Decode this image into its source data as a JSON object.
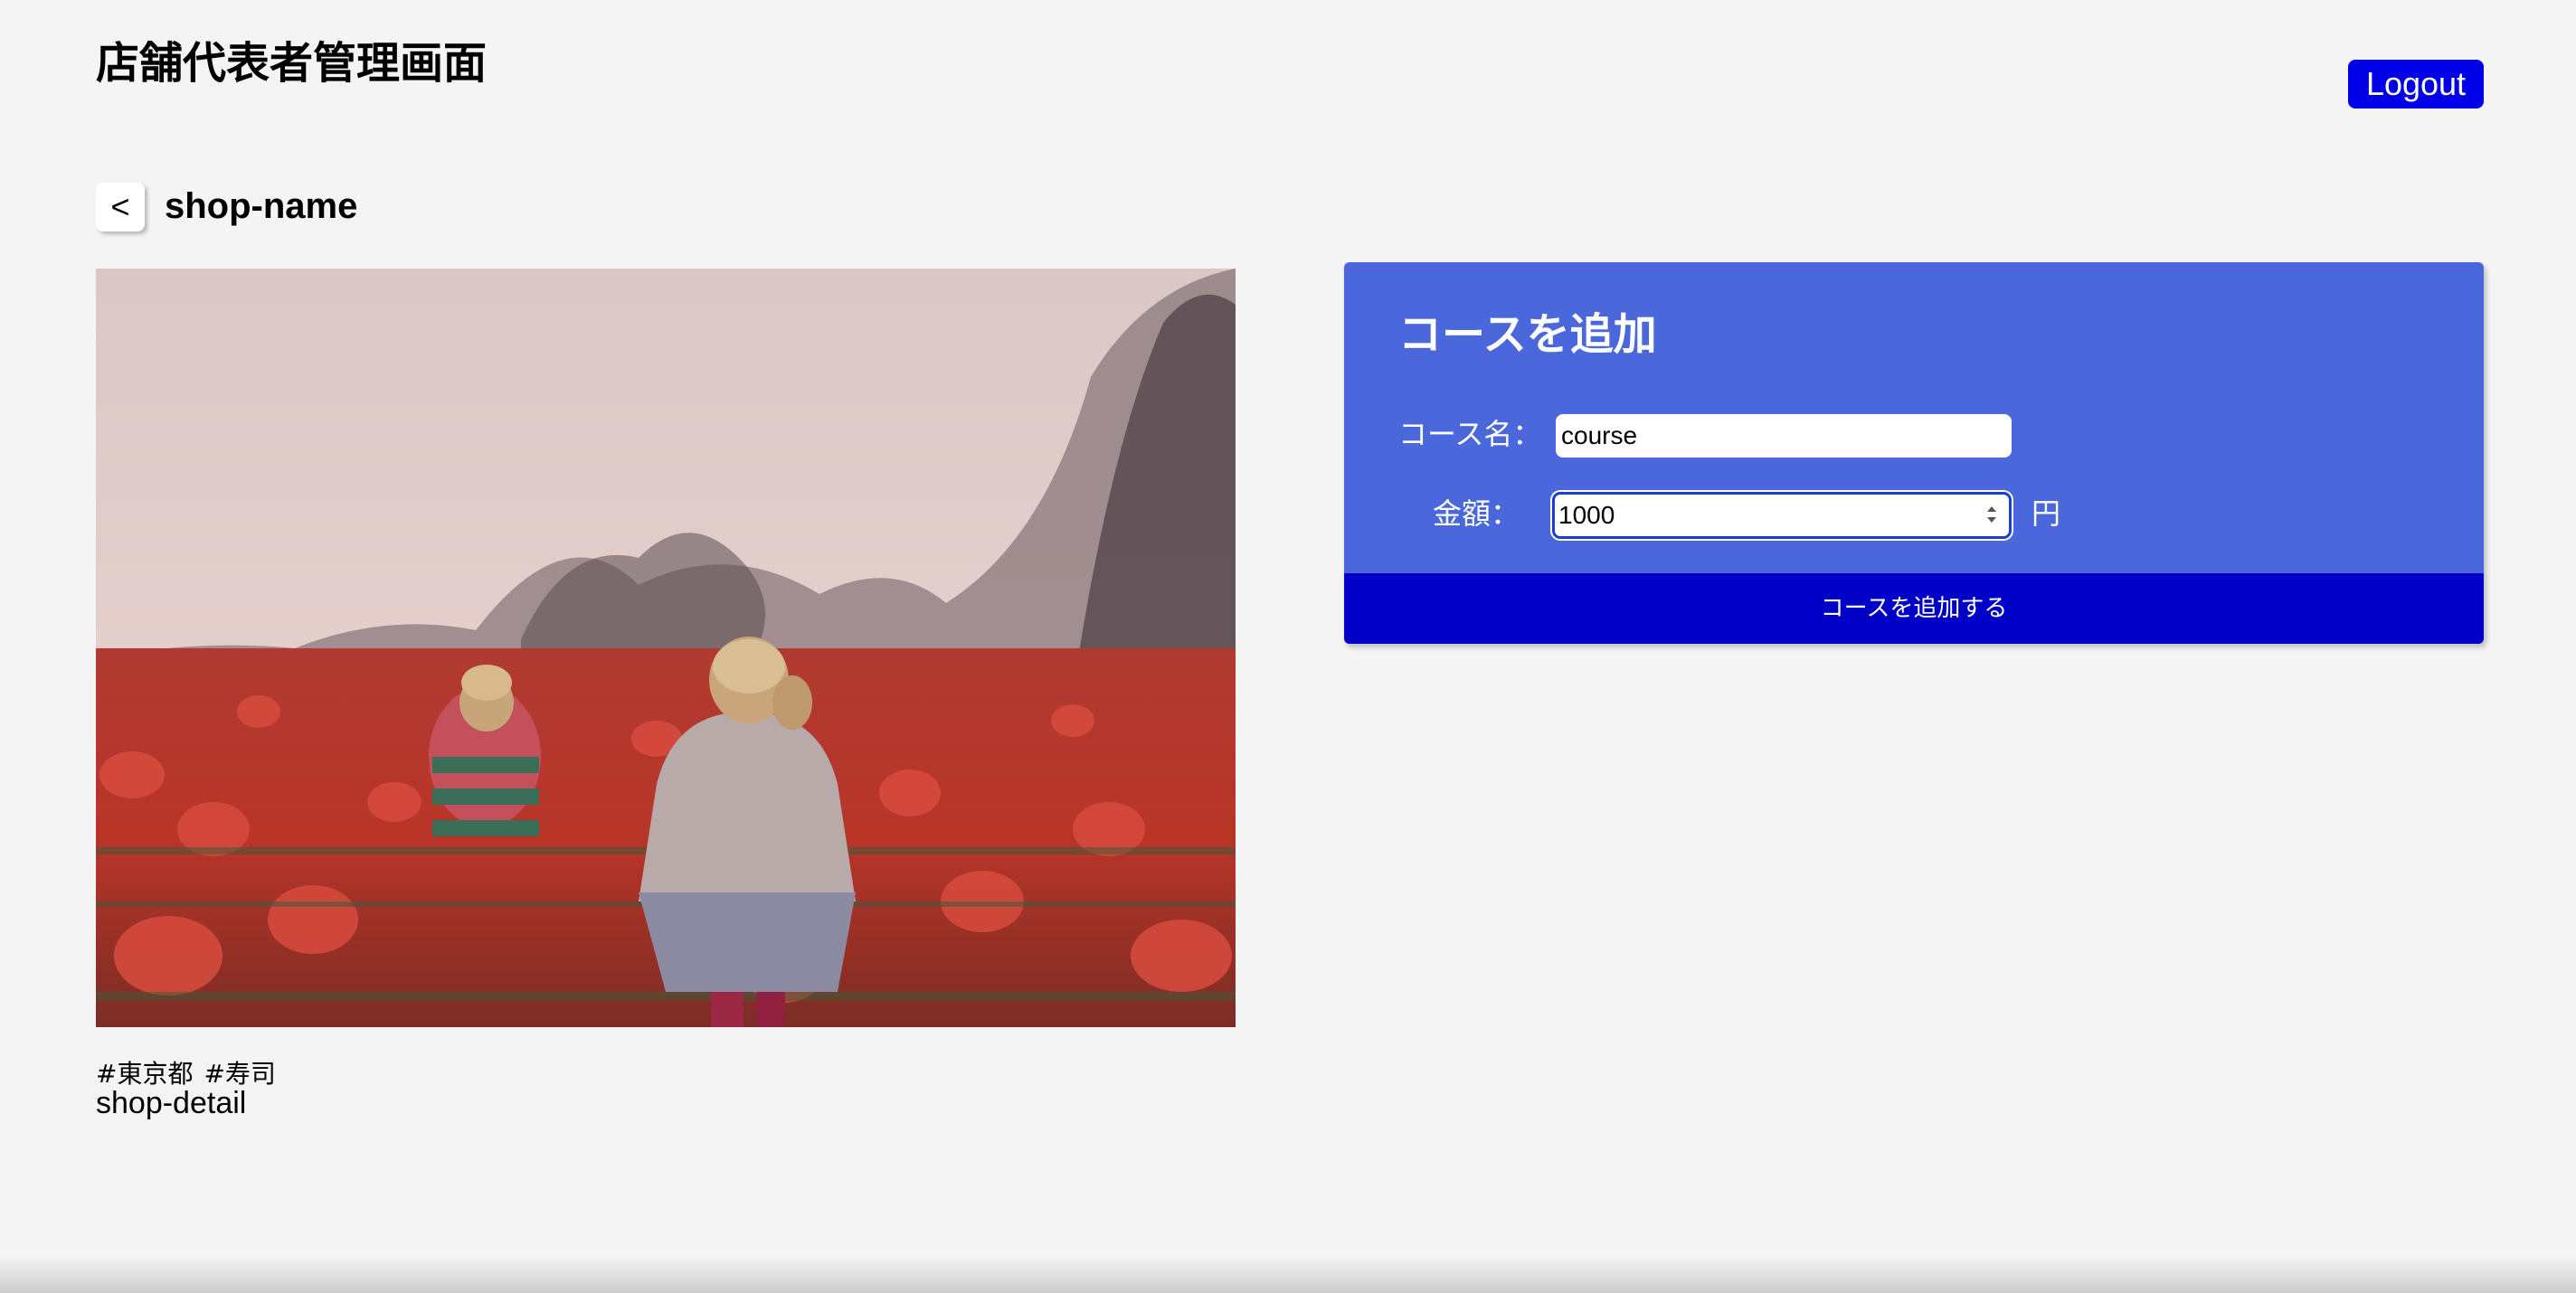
{
  "header": {
    "title": "店舗代表者管理画面",
    "logout_label": "Logout"
  },
  "shop": {
    "back_label": "<",
    "name": "shop-name",
    "tags": [
      "#東京都",
      "#寿司"
    ],
    "detail": "shop-detail"
  },
  "course_form": {
    "title": "コースを追加",
    "name_label": "コース名：",
    "name_value": "course",
    "price_label": "金額：",
    "price_value": "1000",
    "price_unit": "円",
    "submit_label": "コースを追加する"
  },
  "colors": {
    "background": "#f4f4f4",
    "accent_blue": "#0000e6",
    "card_blue": "#4a68dc",
    "submit_blue": "#0000c7"
  },
  "icons": {
    "back": "chevron-left-icon",
    "spinner": "spinner-arrows-icon"
  }
}
